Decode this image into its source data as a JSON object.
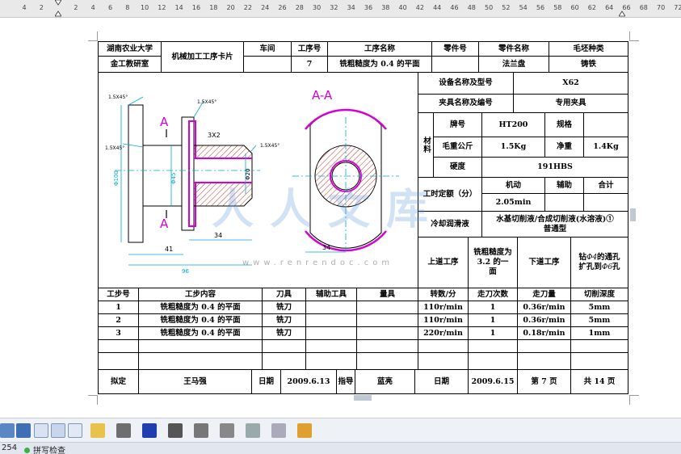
{
  "ruler": {
    "ticks": [
      "4",
      "2",
      "",
      "2",
      "4",
      "6",
      "8",
      "10",
      "12",
      "14",
      "16",
      "18",
      "20",
      "22",
      "24",
      "26",
      "28",
      "30",
      "32",
      "34",
      "36",
      "38",
      "40",
      "42",
      "44",
      "46",
      "48",
      "50",
      "52",
      "54",
      "56",
      "58",
      "60",
      "62",
      "64",
      "66",
      "68",
      "70",
      "72"
    ]
  },
  "header": {
    "university_line1": "湖南农业大学",
    "university_line2": "金工教研室",
    "card_title": "机械加工工序卡片",
    "workshop_label": "车间",
    "workshop_value": "",
    "proc_no_label": "工序号",
    "proc_no_value": "7",
    "proc_name_label": "工序名称",
    "proc_name_value": "铣粗糙度为 0.4 的平面",
    "part_no_label": "零件号",
    "part_no_value": "",
    "part_name_label": "零件名称",
    "part_name_value": "法兰盘",
    "blank_type_label": "毛坯种类",
    "blank_type_value": "铸铁"
  },
  "drawing": {
    "section_title": "A-A",
    "label_a_top": "A",
    "label_a_bottom": "A",
    "chamfer_1": "1.5X45°",
    "chamfer_2": "1.5X45°",
    "chamfer_3": "1.5X45°",
    "chamfer_4": "1.5X45°",
    "dim_groove": "3X2",
    "dim_41": "41",
    "dim_34": "34",
    "dim_total": "96",
    "dim_34_side": "34",
    "dim_100": "Φ100",
    "dim_45": "Φ45",
    "dim_20": "Φ20"
  },
  "right": {
    "equip_label": "设备名称及型号",
    "equip_value": "X62",
    "fixture_label": "夹具名称及编号",
    "fixture_value": "专用夹具",
    "material_label": "材料",
    "grade_label": "牌号",
    "grade_value": "HT200",
    "spec_label": "规格",
    "spec_value": "",
    "weight_label": "毛重公斤",
    "weight_value": "1.5Kg",
    "net_label": "净重",
    "net_value": "1.4Kg",
    "hardness_label": "硬度",
    "hardness_value": "191HBS",
    "time_label": "工时定额（分）",
    "machine_label": "机动",
    "aux_label": "辅助",
    "total_label": "合计",
    "time_value": "2.05min",
    "coolant_label": "冷却润滑液",
    "coolant_value": "水基切削液/合成切削液(水溶液)①普通型",
    "prev_label": "上道工序",
    "prev_value": "铣粗糙度为 3.2 的一面",
    "next_label": "下道工序",
    "next_value_1": "钻",
    "next_value_phi4": "Φ4",
    "next_value_2": "的通孔扩孔到",
    "next_value_phi6": "Φ6",
    "next_value_3": "孔"
  },
  "steps": {
    "headers": {
      "no": "工步号",
      "content": "工步内容",
      "tool": "刀具",
      "aux_tool": "辅助工具",
      "gauge": "量具",
      "speed": "转数/分",
      "passes": "走刀次数",
      "feed": "走刀量",
      "depth": "切削深度"
    },
    "rows": [
      {
        "no": "1",
        "content": "铣粗糙度为 0.4 的平面",
        "tool": "铣刀",
        "aux": "",
        "gauge": "",
        "speed": "110r/min",
        "passes": "1",
        "feed": "0.36r/min",
        "depth": "5mm"
      },
      {
        "no": "2",
        "content": "铣粗糙度为 0.4 的平面",
        "tool": "铣刀",
        "aux": "",
        "gauge": "",
        "speed": "110r/min",
        "passes": "1",
        "feed": "0.36r/min",
        "depth": "5mm"
      },
      {
        "no": "3",
        "content": "铣粗糙度为 0.4 的平面",
        "tool": "铣刀",
        "aux": "",
        "gauge": "",
        "speed": "220r/min",
        "passes": "1",
        "feed": "0.18r/min",
        "depth": "1mm"
      }
    ]
  },
  "footer": {
    "drafter_label": "拟定",
    "drafter_value": "王马强",
    "date_label": "日期",
    "date_value": "2009.6.13",
    "advisor_label": "指导",
    "advisor_value": "蓝亮",
    "date2_label": "日期",
    "date2_value": "2009.6.15",
    "page_label": "第 7 页",
    "total_label": "共 14 页"
  },
  "watermark": {
    "text": "人人文库",
    "url": "www.renrendoc.com"
  },
  "status": {
    "page_num": "254",
    "spell_check": "拼写检查"
  },
  "colors": {
    "magenta": "#d400d4",
    "cyan": "#00a8d8",
    "hatch": "#c0392b"
  }
}
